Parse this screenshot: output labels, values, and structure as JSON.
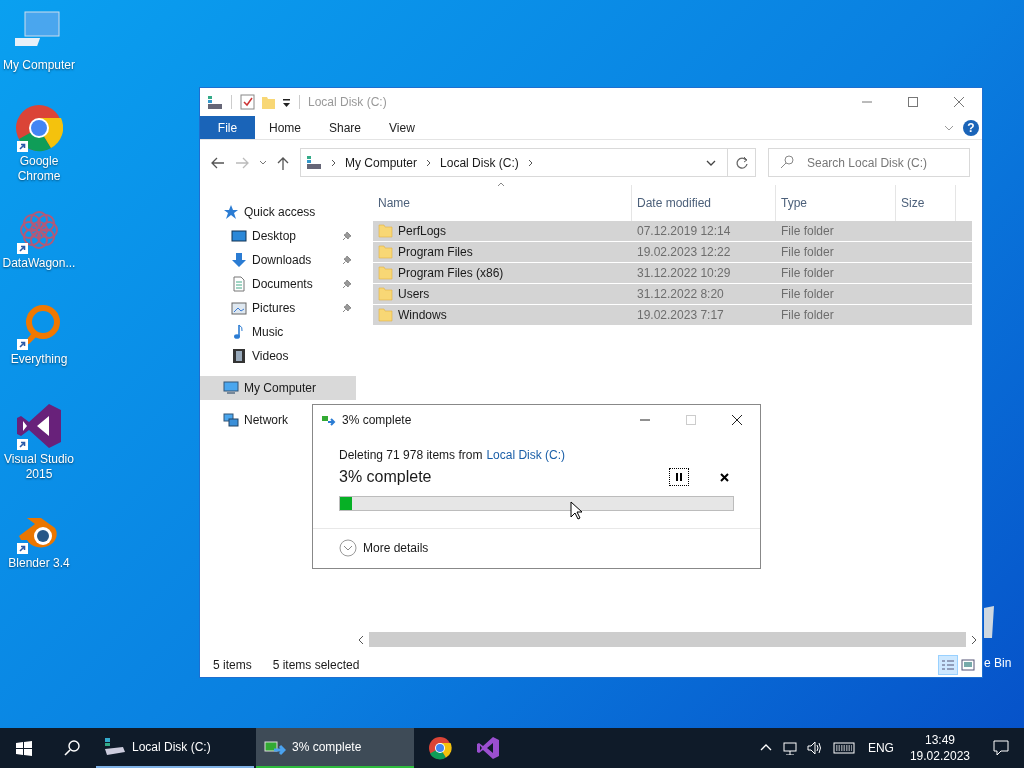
{
  "desktop_icons": [
    {
      "label": "My Computer",
      "kind": "computer",
      "shortcut": false
    },
    {
      "label": "Google Chrome",
      "kind": "chrome",
      "shortcut": true
    },
    {
      "label": "DataWagon...",
      "kind": "datawagon",
      "shortcut": true
    },
    {
      "label": "Everything",
      "kind": "everything",
      "shortcut": true
    },
    {
      "label": "Visual Studio 2015",
      "kind": "vs",
      "shortcut": true
    },
    {
      "label": "Blender 3.4",
      "kind": "blender",
      "shortcut": true
    }
  ],
  "recycle_bin": {
    "label": "e Bin"
  },
  "explorer": {
    "title": "Local Disk (C:)",
    "ribbon_tabs": [
      {
        "label": "File",
        "kind": "file"
      },
      {
        "label": "Home",
        "kind": "tab"
      },
      {
        "label": "Share",
        "kind": "tab"
      },
      {
        "label": "View",
        "kind": "tab"
      }
    ],
    "address": [
      "My Computer",
      "Local Disk (C:)"
    ],
    "help": "?",
    "search": {
      "placeholder": "Search Local Disk (C:)"
    },
    "sidebar": [
      {
        "label": "Quick access",
        "kind": "star",
        "selected": false,
        "children": [
          {
            "label": "Desktop",
            "kind": "desktop",
            "pinned": true
          },
          {
            "label": "Downloads",
            "kind": "downloads",
            "pinned": true
          },
          {
            "label": "Documents",
            "kind": "documents",
            "pinned": true
          },
          {
            "label": "Pictures",
            "kind": "pictures",
            "pinned": true
          },
          {
            "label": "Music",
            "kind": "music",
            "pinned": false
          },
          {
            "label": "Videos",
            "kind": "videos",
            "pinned": false
          }
        ]
      },
      {
        "label": "My Computer",
        "kind": "computer",
        "selected": true
      },
      {
        "label": "Network",
        "kind": "network",
        "selected": false
      }
    ],
    "columns": [
      "Name",
      "Date modified",
      "Type",
      "Size"
    ],
    "rows": [
      {
        "name": "PerfLogs",
        "date": "07.12.2019 12:14",
        "type": "File folder",
        "selected": true
      },
      {
        "name": "Program Files",
        "date": "19.02.2023 12:22",
        "type": "File folder",
        "selected": true
      },
      {
        "name": "Program Files (x86)",
        "date": "31.12.2022 10:29",
        "type": "File folder",
        "selected": true
      },
      {
        "name": "Users",
        "date": "31.12.2022 8:20",
        "type": "File folder",
        "selected": true
      },
      {
        "name": "Windows",
        "date": "19.02.2023 7:17",
        "type": "File folder",
        "selected": true
      }
    ],
    "status_bar": [
      "5 items",
      "5 items selected"
    ]
  },
  "dialog": {
    "title": "3% complete",
    "message": "Deleting 71 978 items from",
    "source": "Local Disk (C:)",
    "heading": "3% complete",
    "level": 0.03,
    "more_details": "More details"
  },
  "taskbar": {
    "items": [
      {
        "kind": "drive",
        "label": "Local Disk (C:)",
        "selected": false
      },
      {
        "kind": "progress",
        "label": "3% complete",
        "selected": true
      },
      {
        "kind": "chrome",
        "selected": false
      },
      {
        "kind": "vs",
        "selected": false
      }
    ],
    "language": "ENG",
    "time": "13:49",
    "date": "19.02.2023"
  }
}
